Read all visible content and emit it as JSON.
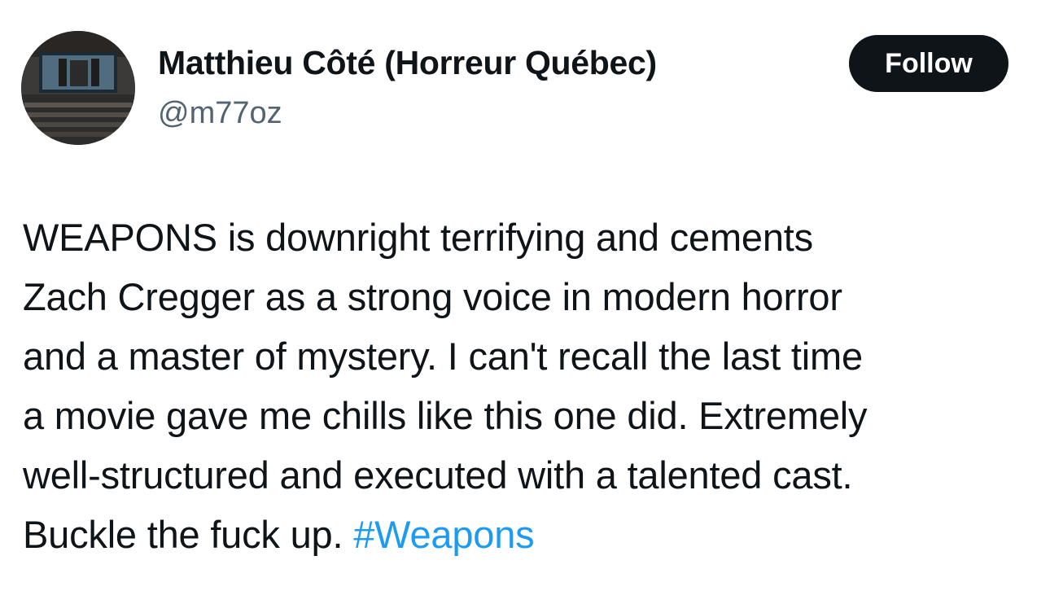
{
  "author": {
    "display_name": "Matthieu Côté (Horreur Québec)",
    "handle": "@m77oz"
  },
  "follow_button": {
    "label": "Follow"
  },
  "tweet": {
    "lines": [
      "WEAPONS is downright terrifying and cements",
      "Zach Cregger as a strong voice in modern horror",
      "and a master of mystery. I can't recall the last time",
      "a movie gave me chills like this one did. Extremely",
      "well-structured and executed with a talented cast.",
      "Buckle the fuck up."
    ],
    "hashtag": "#Weapons"
  },
  "colors": {
    "text": "#0f1419",
    "secondary_text": "#536471",
    "link": "#1d9bf0",
    "button_bg": "#0f1419",
    "button_text": "#ffffff"
  },
  "icons": {
    "avatar": "avatar-cinema-screen-icon"
  }
}
